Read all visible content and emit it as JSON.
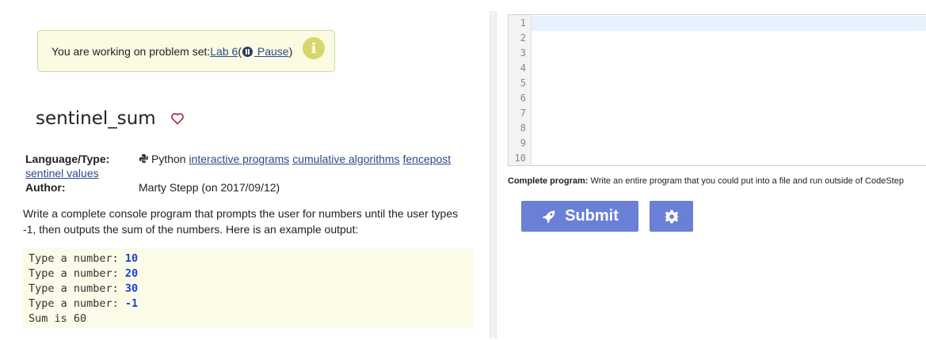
{
  "banner": {
    "prefix": "You are working on problem set: ",
    "link": "Lab 6",
    "open_paren": " (",
    "pause_label": " Pause",
    "close_paren": ")",
    "info_glyph": "i"
  },
  "problem": {
    "title": "sentinel_sum"
  },
  "meta": {
    "language_label": "Language/Type:",
    "language": "Python",
    "tags": [
      "interactive programs",
      "cumulative algorithms",
      "fencepost",
      "sentinel values"
    ],
    "author_label": "Author:",
    "author": "Marty Stepp (on 2017/09/12)"
  },
  "description": "Write a complete console program that prompts the user for numbers until the user types -1, then outputs the sum of the numbers. Here is an example output:",
  "example_output": [
    {
      "prompt": "Type a number: ",
      "input": "10"
    },
    {
      "prompt": "Type a number: ",
      "input": "20"
    },
    {
      "prompt": "Type a number: ",
      "input": "30"
    },
    {
      "prompt": "Type a number: ",
      "input": "-1"
    },
    {
      "prompt": "Sum is 60",
      "input": ""
    }
  ],
  "editor": {
    "line_numbers": [
      "1",
      "2",
      "3",
      "4",
      "5",
      "6",
      "7",
      "8",
      "9",
      "10"
    ]
  },
  "complete_program": {
    "label": "Complete program:",
    "text": " Write an entire program that you could put into a file and run outside of CodeStep"
  },
  "submit": {
    "label": "Submit"
  },
  "colors": {
    "accent": "#6a7fd6",
    "banner_bg": "#fbfbe3",
    "input_text": "#1a3fd6"
  }
}
